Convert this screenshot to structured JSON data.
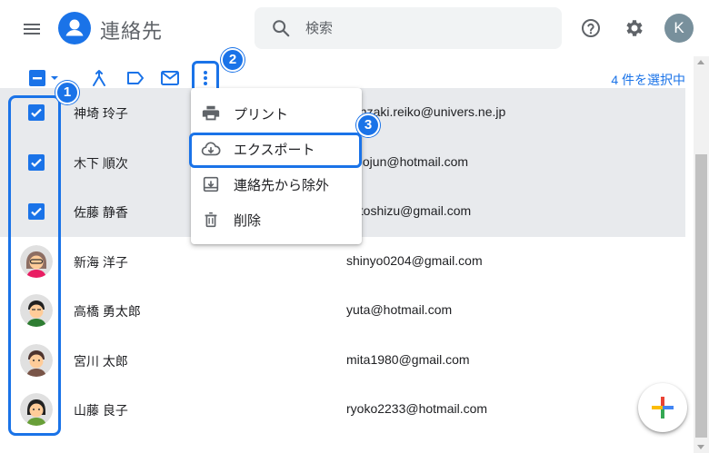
{
  "header": {
    "app_title": "連絡先",
    "search_placeholder": "検索",
    "avatar_letter": "K",
    "icons": [
      "menu-icon",
      "contacts-logo-icon",
      "search-icon",
      "help-icon",
      "gear-icon"
    ]
  },
  "toolbar": {
    "selected_count": "4 件を選択中",
    "icons": [
      "select-checkbox-icon",
      "chevron-down-icon",
      "merge-icon",
      "label-icon",
      "mail-icon",
      "more-vert-icon"
    ]
  },
  "menu": {
    "items": [
      {
        "label": "プリント",
        "icon": "print-icon"
      },
      {
        "label": "エクスポート",
        "icon": "cloud-download-icon"
      },
      {
        "label": "連絡先から除外",
        "icon": "archive-icon"
      },
      {
        "label": "削除",
        "icon": "trash-icon"
      }
    ]
  },
  "badges": [
    "1",
    "2",
    "3"
  ],
  "contacts": [
    {
      "name": "神埼 玲子",
      "email": "kanzaki.reiko@univers.ne.jp",
      "selected": true
    },
    {
      "name": "木下 順次",
      "email": "kinojun@hotmail.com",
      "selected": true
    },
    {
      "name": "佐藤 静香",
      "email": "satoshizu@gmail.com",
      "selected": true
    },
    {
      "name": "新海 洋子",
      "email": "shinyo0204@gmail.com",
      "selected": false
    },
    {
      "name": "高橋 勇太郎",
      "email": "yuta@hotmail.com",
      "selected": false
    },
    {
      "name": "宮川 太郎",
      "email": "mita1980@gmail.com",
      "selected": false
    },
    {
      "name": "山藤 良子",
      "email": "ryoko2233@hotmail.com",
      "selected": false
    }
  ],
  "colors": {
    "accent": "#1a73e8",
    "selected_row": "#e8eaed",
    "icon_gray": "#5f6368"
  }
}
